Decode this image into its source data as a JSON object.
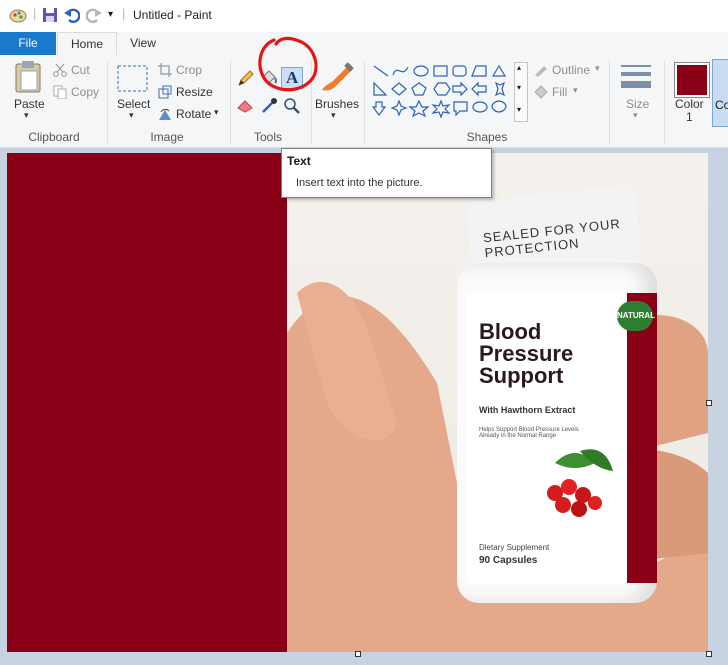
{
  "title_bar": {
    "title": "Untitled - Paint"
  },
  "tabs": {
    "file": "File",
    "home": "Home",
    "view": "View"
  },
  "clipboard": {
    "paste": "Paste",
    "cut": "Cut",
    "copy": "Copy",
    "group": "Clipboard"
  },
  "image": {
    "select": "Select",
    "crop": "Crop",
    "resize": "Resize",
    "rotate": "Rotate",
    "group": "Image"
  },
  "tools": {
    "group": "Tools",
    "text_tool_glyph": "A"
  },
  "brushes": {
    "label": "Brushes"
  },
  "shapes": {
    "group": "Shapes",
    "outline": "Outline",
    "fill": "Fill"
  },
  "size": {
    "label": "Size"
  },
  "colors": {
    "color1_label": "Color",
    "color1_number": "1",
    "color2_label_partial": "Co",
    "selected_color": "#8a0016",
    "accent": "#1979ca"
  },
  "tooltip": {
    "title": "Text",
    "description": "Insert text into the picture."
  },
  "photo": {
    "cap_text": "SEALED FOR YOUR PROTECTION",
    "badge": "NATURAL",
    "product_line1": "Blood",
    "product_line2": "Pressure",
    "product_line3": "Support",
    "subtitle": "With Hawthorn Extract",
    "small_text": "Helps Support Blood Pressure Levels Already in the Normal Range",
    "dietary": "Dietary Supplement",
    "count": "90 Capsules"
  }
}
